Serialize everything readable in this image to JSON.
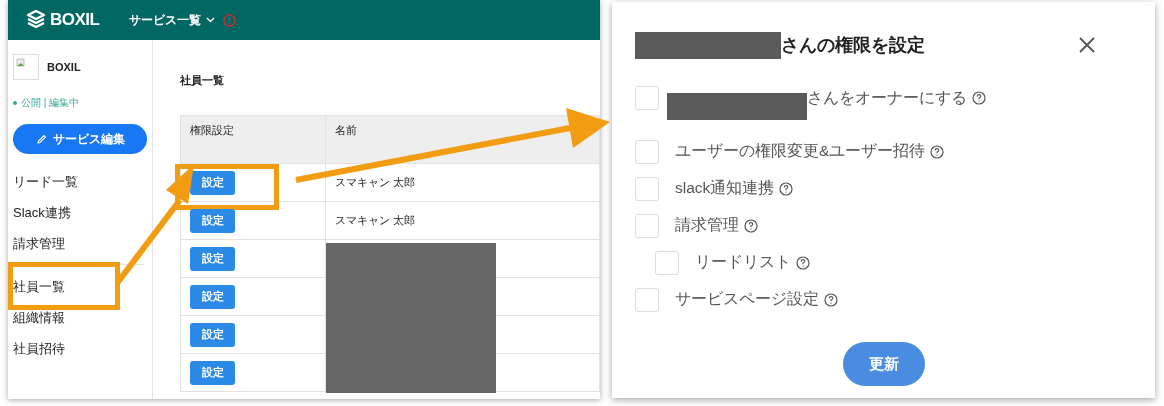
{
  "header": {
    "logo": "BOXIL",
    "service_menu": "サービス一覧"
  },
  "sidebar": {
    "service_name": "BOXIL",
    "status": "公開 | 編集中",
    "edit_button": "サービス編集",
    "groups": [
      {
        "items": [
          {
            "label": "リード一覧",
            "highlighted": false
          },
          {
            "label": "Slack連携",
            "highlighted": false
          },
          {
            "label": "請求管理",
            "highlighted": false
          }
        ]
      },
      {
        "items": [
          {
            "label": "社員一覧",
            "highlighted": true
          },
          {
            "label": "組織情報",
            "highlighted": false
          },
          {
            "label": "社員招待",
            "highlighted": false
          }
        ]
      }
    ]
  },
  "page_title": "社員一覧",
  "table": {
    "columns": [
      "権限設定",
      "名前"
    ],
    "rows": [
      {
        "button": "設定",
        "name": "スマキャン 太郎",
        "redacted": false,
        "highlighted": true
      },
      {
        "button": "設定",
        "name": "スマキャン 太郎",
        "redacted": false,
        "highlighted": false
      },
      {
        "button": "設定",
        "redacted": true,
        "highlighted": false
      },
      {
        "button": "設定",
        "redacted": true,
        "highlighted": false
      },
      {
        "button": "設定",
        "redacted": true,
        "highlighted": false
      },
      {
        "button": "設定",
        "redacted": true,
        "highlighted": false
      }
    ]
  },
  "dialog": {
    "title": "さんの権限を設定",
    "title_redacted": true,
    "options": [
      {
        "label": "さんをオーナーにする",
        "checked": false,
        "redacted_prefix": true
      },
      {
        "label": "ユーザーの権限変更&ユーザー招待",
        "checked": false,
        "redacted_prefix": false
      },
      {
        "label": "slack通知連携",
        "checked": false,
        "redacted_prefix": false
      },
      {
        "label": "請求管理",
        "checked": false,
        "redacted_prefix": false,
        "children": [
          {
            "label": "リードリスト",
            "checked": false,
            "redacted_prefix": false
          }
        ]
      },
      {
        "label": "サービスページ設定",
        "checked": false,
        "redacted_prefix": false
      }
    ],
    "submit": "更新"
  }
}
